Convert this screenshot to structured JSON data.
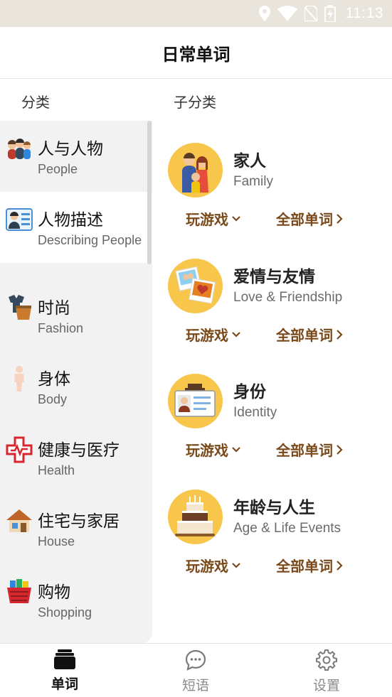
{
  "status_bar": {
    "time": "11:13"
  },
  "header": {
    "title": "日常单词"
  },
  "columns": {
    "category": "分类",
    "subcategory": "子分类"
  },
  "sidebar": {
    "items": [
      {
        "zh": "人与人物",
        "en": "People",
        "icon": "people-icon"
      },
      {
        "zh": "人物描述",
        "en": "Describing People",
        "icon": "id-card-icon"
      },
      {
        "zh": "时尚",
        "en": "Fashion",
        "icon": "clothes-icon"
      },
      {
        "zh": "身体",
        "en": "Body",
        "icon": "body-icon"
      },
      {
        "zh": "健康与医疗",
        "en": "Health",
        "icon": "medical-cross-icon"
      },
      {
        "zh": "住宅与家居",
        "en": "House",
        "icon": "house-icon"
      },
      {
        "zh": "购物",
        "en": "Shopping",
        "icon": "shopping-basket-icon"
      }
    ],
    "active_index": 1
  },
  "subcategories": [
    {
      "zh": "家人",
      "en": "Family",
      "icon": "family-icon"
    },
    {
      "zh": "爱情与友情",
      "en": "Love & Friendship",
      "icon": "photos-icon"
    },
    {
      "zh": "身份",
      "en": "Identity",
      "icon": "identity-card-icon"
    },
    {
      "zh": "年龄与人生",
      "en": "Age & Life Events",
      "icon": "birthday-cake-icon"
    }
  ],
  "actions": {
    "play": "玩游戏",
    "all_words": "全部单词"
  },
  "bottom_nav": [
    {
      "label": "单词",
      "icon": "cards-icon",
      "active": true
    },
    {
      "label": "短语",
      "icon": "chat-bubble-icon",
      "active": false
    },
    {
      "label": "设置",
      "icon": "gear-icon",
      "active": false
    }
  ],
  "colors": {
    "accent": "#7a4a1b",
    "circle": "#f7c64a",
    "sidebar_bg": "#f2f2f2",
    "status_bar": "#e9e4dc"
  }
}
